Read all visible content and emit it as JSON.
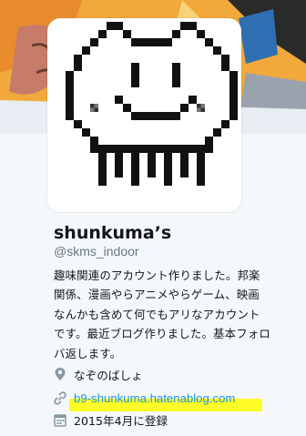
{
  "profile": {
    "display_name": "shunkuma’s",
    "screen_name": "@skms_indoor",
    "bio_lines": [
      "趣味関連のアカウント作りました。邦楽",
      "関係、漫画やらアニメやらゲーム、映画",
      "なんかも含めて何でもアリなアカウント",
      "です。最近ブログ作りました。基本フォロ",
      "バ返します。"
    ],
    "location": "なぞのばしょ",
    "website": "b9-shunkuma.hatenablog.com",
    "joined": "2015年4月に登録"
  },
  "icons": {
    "location": "map-pin-icon",
    "website": "link-icon",
    "joined": "calendar-icon"
  },
  "colors": {
    "link": "#1b95e0",
    "highlight": "#fffb00",
    "secondary_text": "#657786",
    "icon": "#8899a6"
  }
}
